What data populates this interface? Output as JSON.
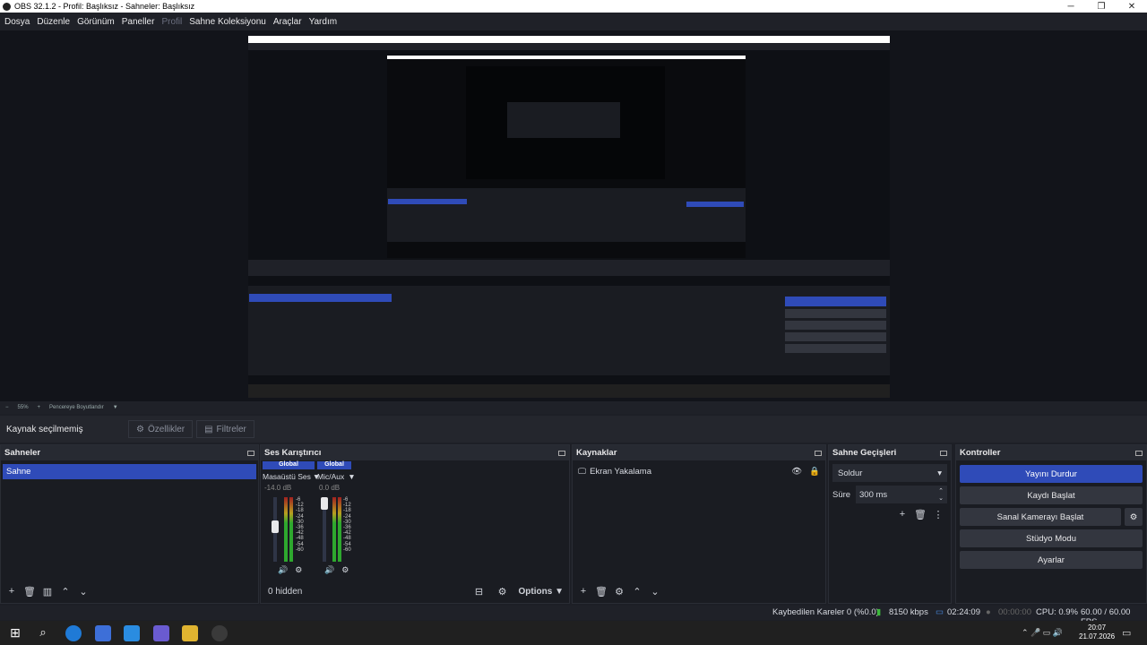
{
  "window": {
    "title": "OBS 32.1.2 - Profil: Başlıksız - Sahneler: Başlıksız"
  },
  "menu": [
    "Dosya",
    "Düzenle",
    "Görünüm",
    "Paneller",
    "Profil",
    "Sahne Koleksiyonu",
    "Araçlar",
    "Yardım"
  ],
  "zoom": {
    "minus": "−",
    "value": "55%",
    "plus": "+",
    "mode": "Pencereye Boyutlandır"
  },
  "source_bar": {
    "label": "Kaynak seçilmemiş",
    "properties": "Özellikler",
    "filters": "Filtreler"
  },
  "scenes": {
    "title": "Sahneler",
    "items": [
      "Sahne"
    ]
  },
  "mixer": {
    "title": "Ses Karıştırıcı",
    "channels": [
      {
        "tag": "Global",
        "name": "Masaüstü Ses",
        "db": "-14.0 dB",
        "level": 0.55
      },
      {
        "tag": "Global",
        "name": "Mic/Aux",
        "db": "0.0 dB",
        "level": 0.75
      }
    ],
    "ticks": [
      "-6",
      "-12",
      "-18",
      "-24",
      "-30",
      "-36",
      "-42",
      "-48",
      "-54",
      "-60"
    ],
    "hidden": "0 hidden",
    "options": "Options"
  },
  "sources": {
    "title": "Kaynaklar",
    "items": [
      "Ekran Yakalama"
    ]
  },
  "transitions": {
    "title": "Sahne Geçişleri",
    "type": "Soldur",
    "duration_label": "Süre",
    "duration": "300 ms"
  },
  "controls": {
    "title": "Kontroller",
    "buttons": [
      "Yayını Durdur",
      "Kaydı Başlat",
      "Sanal Kamerayı Başlat",
      "Stüdyo Modu",
      "Ayarlar"
    ]
  },
  "status": {
    "dropped": "Kaybedilen Kareler 0 (%0.0)",
    "bitrate": "8150 kbps",
    "stream_time": "02:24:09",
    "rec_time": "00:00:00",
    "cpu": "CPU: 0.9%",
    "fps": "60.00 / 60.00 FPS"
  },
  "clock": {
    "time": "20:07",
    "date": "21.07.2026"
  },
  "colors": {
    "accent": "#2f4bb8",
    "bg": "#1d1f26"
  }
}
